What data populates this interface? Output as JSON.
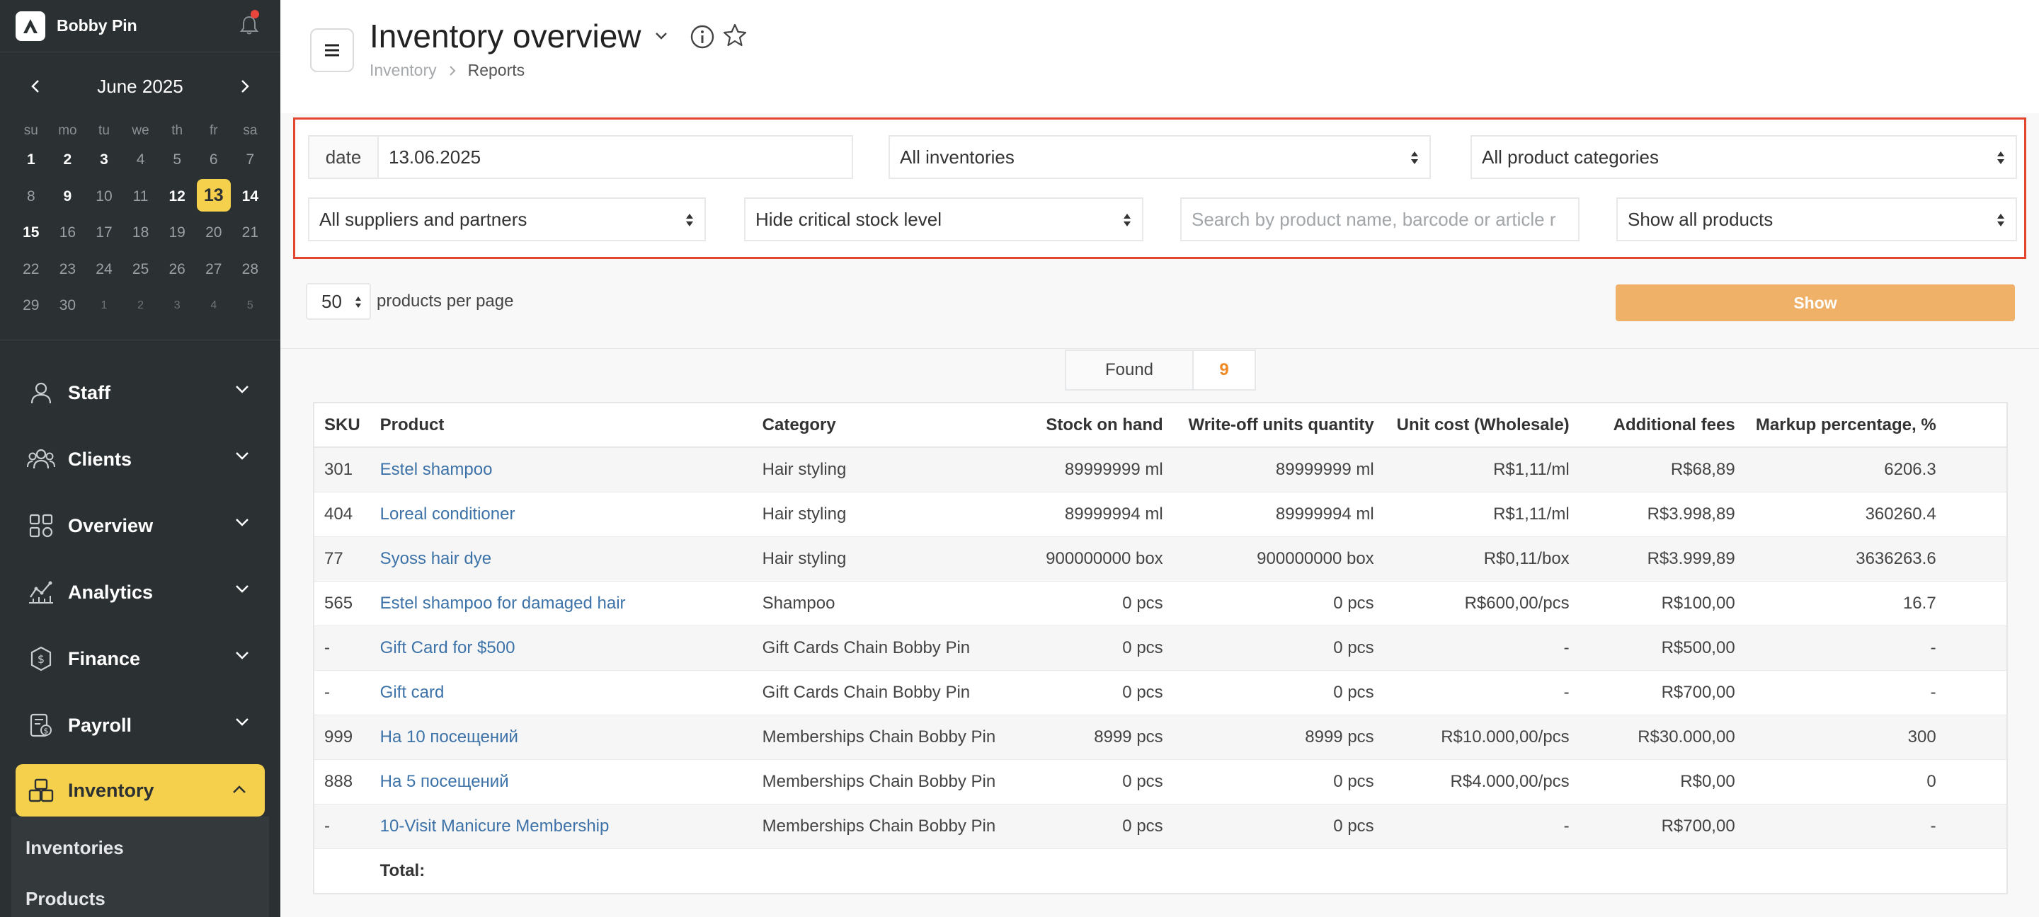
{
  "sidebar": {
    "brand": "Bobby Pin",
    "calendar": {
      "month_label": "June 2025",
      "dow": [
        "su",
        "mo",
        "tu",
        "we",
        "th",
        "fr",
        "sa"
      ],
      "weeks": [
        [
          {
            "d": "1",
            "s": "busy"
          },
          {
            "d": "2",
            "s": "busy"
          },
          {
            "d": "3",
            "s": "busy"
          },
          {
            "d": "4",
            "s": ""
          },
          {
            "d": "5",
            "s": ""
          },
          {
            "d": "6",
            "s": ""
          },
          {
            "d": "7",
            "s": ""
          }
        ],
        [
          {
            "d": "8",
            "s": ""
          },
          {
            "d": "9",
            "s": "busy"
          },
          {
            "d": "10",
            "s": ""
          },
          {
            "d": "11",
            "s": ""
          },
          {
            "d": "12",
            "s": "busy"
          },
          {
            "d": "13",
            "s": "today"
          },
          {
            "d": "14",
            "s": "busy"
          }
        ],
        [
          {
            "d": "15",
            "s": "busy"
          },
          {
            "d": "16",
            "s": ""
          },
          {
            "d": "17",
            "s": ""
          },
          {
            "d": "18",
            "s": ""
          },
          {
            "d": "19",
            "s": ""
          },
          {
            "d": "20",
            "s": ""
          },
          {
            "d": "21",
            "s": ""
          }
        ],
        [
          {
            "d": "22",
            "s": ""
          },
          {
            "d": "23",
            "s": ""
          },
          {
            "d": "24",
            "s": ""
          },
          {
            "d": "25",
            "s": ""
          },
          {
            "d": "26",
            "s": ""
          },
          {
            "d": "27",
            "s": ""
          },
          {
            "d": "28",
            "s": ""
          }
        ],
        [
          {
            "d": "29",
            "s": ""
          },
          {
            "d": "30",
            "s": ""
          },
          {
            "d": "1",
            "s": "muted"
          },
          {
            "d": "2",
            "s": "muted"
          },
          {
            "d": "3",
            "s": "muted"
          },
          {
            "d": "4",
            "s": "muted"
          },
          {
            "d": "5",
            "s": "muted"
          }
        ]
      ]
    },
    "nav": [
      {
        "label": "Staff",
        "icon": "person-icon"
      },
      {
        "label": "Clients",
        "icon": "clients-icon"
      },
      {
        "label": "Overview",
        "icon": "grid-icon"
      },
      {
        "label": "Analytics",
        "icon": "analytics-icon"
      },
      {
        "label": "Finance",
        "icon": "dollar-icon"
      },
      {
        "label": "Payroll",
        "icon": "payroll-icon"
      }
    ],
    "active_nav": {
      "label": "Inventory",
      "icon": "boxes-icon"
    },
    "subnav": [
      "Inventories",
      "Products"
    ]
  },
  "header": {
    "title": "Inventory overview",
    "breadcrumb": {
      "parent": "Inventory",
      "current": "Reports"
    }
  },
  "filters": {
    "date_label": "date",
    "date_value": "13.06.2025",
    "inventories": "All inventories",
    "categories": "All product categories",
    "suppliers": "All suppliers and partners",
    "stock_level": "Hide critical stock level",
    "search_placeholder": "Search by product name, barcode or article r",
    "products_filter": "Show all products",
    "per_page": "50",
    "per_page_label": "products per page",
    "show_button": "Show"
  },
  "found": {
    "label": "Found",
    "count": "9"
  },
  "table": {
    "columns": [
      "SKU",
      "Product",
      "Category",
      "Stock on hand",
      "Write-off units quantity",
      "Unit cost (Wholesale)",
      "Additional fees",
      "Markup percentage, %"
    ],
    "rows": [
      [
        "301",
        "Estel shampoo",
        "Hair styling",
        "89999999 ml",
        "89999999 ml",
        "R$1,11/ml",
        "R$68,89",
        "6206.3"
      ],
      [
        "404",
        "Loreal conditioner",
        "Hair styling",
        "89999994 ml",
        "89999994 ml",
        "R$1,11/ml",
        "R$3.998,89",
        "360260.4"
      ],
      [
        "77",
        "Syoss hair dye",
        "Hair styling",
        "900000000 box",
        "900000000 box",
        "R$0,11/box",
        "R$3.999,89",
        "3636263.6"
      ],
      [
        "565",
        "Estel shampoo for damaged hair",
        "Shampoo",
        "0 pcs",
        "0 pcs",
        "R$600,00/pcs",
        "R$100,00",
        "16.7"
      ],
      [
        "-",
        "Gift Card for $500",
        "Gift Cards Chain Bobby Pin",
        "0 pcs",
        "0 pcs",
        "-",
        "R$500,00",
        "-"
      ],
      [
        "-",
        "Gift card",
        "Gift Cards Chain Bobby Pin",
        "0 pcs",
        "0 pcs",
        "-",
        "R$700,00",
        "-"
      ],
      [
        "999",
        "На 10 посещений",
        "Memberships Chain Bobby Pin",
        "8999 pcs",
        "8999 pcs",
        "R$10.000,00/pcs",
        "R$30.000,00",
        "300"
      ],
      [
        "888",
        "На 5 посещений",
        "Memberships Chain Bobby Pin",
        "0 pcs",
        "0 pcs",
        "R$4.000,00/pcs",
        "R$0,00",
        "0"
      ],
      [
        "-",
        "10-Visit Manicure Membership",
        "Memberships Chain Bobby Pin",
        "0 pcs",
        "0 pcs",
        "-",
        "R$700,00",
        "-"
      ]
    ],
    "total_label": "Total:"
  },
  "colors": {
    "accent": "#f5d04c",
    "sidebar": "#2b3032",
    "show_button": "#efb067",
    "filter_border": "#e3452e",
    "link": "#3c72a8",
    "found_count": "#f08a24"
  }
}
